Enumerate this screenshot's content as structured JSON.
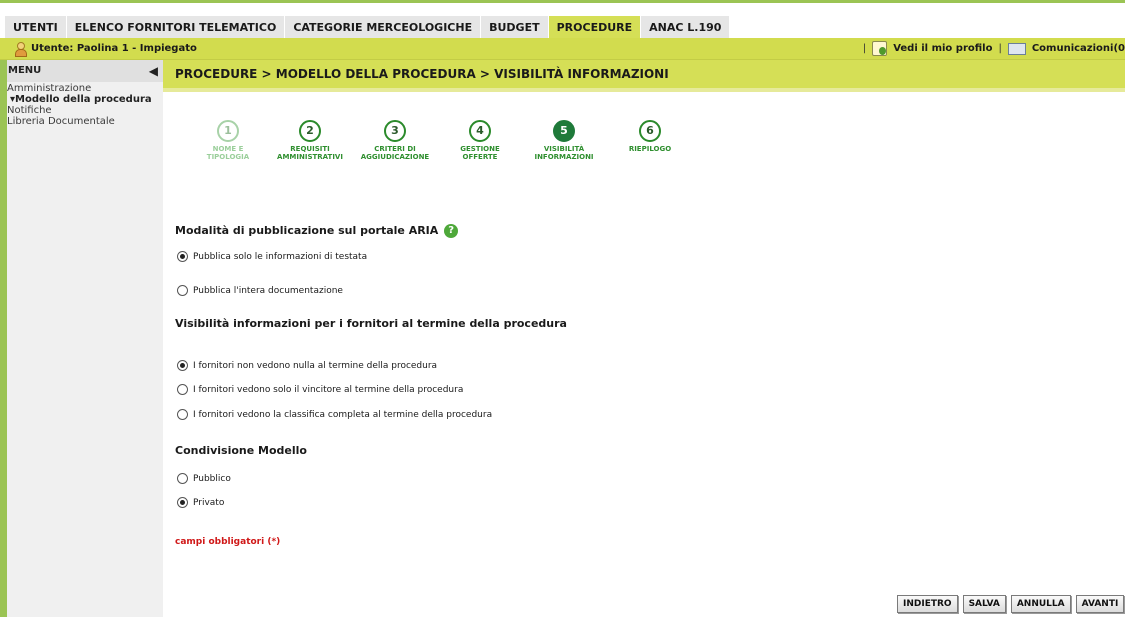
{
  "topnav": {
    "tabs": [
      "UTENTI",
      "ELENCO FORNITORI TELEMATICO",
      "CATEGORIE MERCEOLOGICHE",
      "BUDGET",
      "PROCEDURE",
      "ANAC L.190"
    ],
    "active": "PROCEDURE"
  },
  "userbar": {
    "user_label": "Utente: Paolina 1 - Impiegato",
    "profile_link": "Vedi il mio profilo",
    "separator": "|",
    "comm_link": "Comunicazioni(0"
  },
  "sidebar": {
    "menu_title": "MENU",
    "items": [
      "Amministrazione",
      "▾Modello della procedura",
      "Notifiche",
      "Libreria Documentale"
    ]
  },
  "breadcrumb": "PROCEDURE  > MODELLO DELLA PROCEDURA  > VISIBILITÀ INFORMAZIONI",
  "steps": [
    {
      "num": "1",
      "line1": "NOME E",
      "line2": "TIPOLOGIA",
      "state": "done"
    },
    {
      "num": "2",
      "line1": "REQUISITI",
      "line2": "AMMINISTRATIVI",
      "state": "todo"
    },
    {
      "num": "3",
      "line1": "CRITERI DI",
      "line2": "AGGIUDICAZIONE",
      "state": "todo"
    },
    {
      "num": "4",
      "line1": "GESTIONE",
      "line2": "OFFERTE",
      "state": "todo"
    },
    {
      "num": "5",
      "line1": "VISIBILITÀ",
      "line2": "INFORMAZIONI",
      "state": "current"
    },
    {
      "num": "6",
      "line1": "RIEPILOGO",
      "line2": "",
      "state": "todo"
    }
  ],
  "form": {
    "publication": {
      "title": "Modalità di pubblicazione sul portale ARIA",
      "help": "?",
      "options": [
        "Pubblica solo le informazioni di testata",
        "Pubblica l'intera documentazione"
      ],
      "selected": 0
    },
    "visibility": {
      "title": "Visibilità informazioni per i fornitori al termine della procedura",
      "options": [
        "I fornitori non vedono nulla al termine della procedura",
        "I fornitori vedono solo il vincitore al termine della procedura",
        "I fornitori vedono la classifica completa al termine della procedura"
      ],
      "selected": 0
    },
    "sharing": {
      "title": "Condivisione Modello",
      "options": [
        "Pubblico",
        "Privato"
      ],
      "selected": 1
    },
    "required_note": "campi obbligatori (*)"
  },
  "buttons": {
    "back": "INDIETRO",
    "save": "SALVA",
    "cancel": "ANNULLA",
    "next": "AVANTI"
  }
}
